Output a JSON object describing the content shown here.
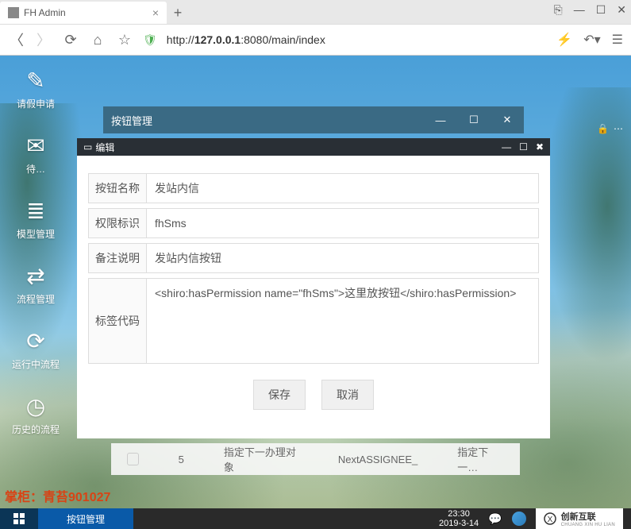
{
  "browser": {
    "tab_title": "FH Admin",
    "url_prefix": "http://",
    "url_host": "127.0.0.1",
    "url_suffix": ":8080/main/index"
  },
  "sidebar": {
    "items": [
      {
        "icon": "✎",
        "label": "请假申请"
      },
      {
        "icon": "✉",
        "label": "待…"
      },
      {
        "icon": "≣",
        "label": "模型管理"
      },
      {
        "icon": "⇄",
        "label": "流程管理"
      },
      {
        "icon": "⟳",
        "label": "运行中流程"
      },
      {
        "icon": "◷",
        "label": "历史的流程"
      }
    ]
  },
  "inner_window": {
    "title": "按钮管理"
  },
  "dialog": {
    "title": "编辑",
    "fields": {
      "name_label": "按钮名称",
      "name_value": "发站内信",
      "perm_label": "权限标识",
      "perm_value": "fhSms",
      "remark_label": "备注说明",
      "remark_value": "发站内信按钮",
      "code_label": "标签代码",
      "code_value": "<shiro:hasPermission name=\"fhSms\">这里放按钮</shiro:hasPermission>"
    },
    "buttons": {
      "save": "保存",
      "cancel": "取消"
    }
  },
  "table_row": {
    "c1": "5",
    "c2": "指定下一办理对象",
    "c3": "NextASSIGNEE_",
    "c4": "指定下一…"
  },
  "watermark": "掌柜：青苔901027",
  "taskbar": {
    "active_task": "按钮管理",
    "time": "23:30",
    "date": "2019-3-14",
    "brand": "创新互联",
    "brand_sub": "CHUANG XIN HU LIAN"
  }
}
